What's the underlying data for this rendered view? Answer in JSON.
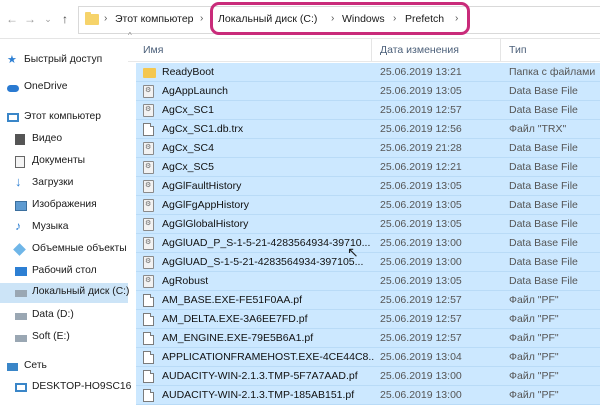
{
  "address": {
    "crumbs": [
      "Этот компьютер",
      "Локальный диск (C:)",
      "Windows",
      "Prefetch"
    ]
  },
  "sidebar": {
    "items": [
      {
        "label": "Быстрый доступ",
        "icon": "star-icon"
      },
      {
        "label": "OneDrive",
        "icon": "cloud-icon"
      },
      {
        "label": "Этот компьютер",
        "icon": "computer-icon"
      },
      {
        "label": "Видео",
        "icon": "video-icon"
      },
      {
        "label": "Документы",
        "icon": "documents-icon"
      },
      {
        "label": "Загрузки",
        "icon": "download-icon"
      },
      {
        "label": "Изображения",
        "icon": "pictures-icon"
      },
      {
        "label": "Музыка",
        "icon": "music-icon"
      },
      {
        "label": "Объемные объекты",
        "icon": "3d-objects-icon"
      },
      {
        "label": "Рабочий стол",
        "icon": "desktop-icon"
      },
      {
        "label": "Локальный диск (C:)",
        "icon": "drive-icon"
      },
      {
        "label": "Data (D:)",
        "icon": "drive-icon"
      },
      {
        "label": "Soft (E:)",
        "icon": "drive-icon"
      },
      {
        "label": "Сеть",
        "icon": "network-icon"
      },
      {
        "label": "DESKTOP-HO9SC16",
        "icon": "computer-icon"
      }
    ]
  },
  "columns": {
    "name": "Имя",
    "date": "Дата изменения",
    "type": "Тип"
  },
  "files": [
    {
      "name": "ReadyBoot",
      "date": "25.06.2019 13:21",
      "type": "Папка с файлами",
      "icon": "folder-icon"
    },
    {
      "name": "AgAppLaunch",
      "date": "25.06.2019 13:05",
      "type": "Data Base File",
      "icon": "database-file-icon"
    },
    {
      "name": "AgCx_SC1",
      "date": "25.06.2019 12:57",
      "type": "Data Base File",
      "icon": "database-file-icon"
    },
    {
      "name": "AgCx_SC1.db.trx",
      "date": "25.06.2019 12:56",
      "type": "Файл \"TRX\"",
      "icon": "file-icon"
    },
    {
      "name": "AgCx_SC4",
      "date": "25.06.2019 21:28",
      "type": "Data Base File",
      "icon": "database-file-icon"
    },
    {
      "name": "AgCx_SC5",
      "date": "25.06.2019 12:21",
      "type": "Data Base File",
      "icon": "database-file-icon"
    },
    {
      "name": "AgGlFaultHistory",
      "date": "25.06.2019 13:05",
      "type": "Data Base File",
      "icon": "database-file-icon"
    },
    {
      "name": "AgGlFgAppHistory",
      "date": "25.06.2019 13:05",
      "type": "Data Base File",
      "icon": "database-file-icon"
    },
    {
      "name": "AgGlGlobalHistory",
      "date": "25.06.2019 13:05",
      "type": "Data Base File",
      "icon": "database-file-icon"
    },
    {
      "name": "AgGlUAD_P_S-1-5-21-4283564934-39710...",
      "date": "25.06.2019 13:00",
      "type": "Data Base File",
      "icon": "database-file-icon"
    },
    {
      "name": "AgGlUAD_S-1-5-21-4283564934-397105...",
      "date": "25.06.2019 13:00",
      "type": "Data Base File",
      "icon": "database-file-icon"
    },
    {
      "name": "AgRobust",
      "date": "25.06.2019 13:05",
      "type": "Data Base File",
      "icon": "database-file-icon"
    },
    {
      "name": "AM_BASE.EXE-FE51F0AA.pf",
      "date": "25.06.2019 12:57",
      "type": "Файл \"PF\"",
      "icon": "file-icon"
    },
    {
      "name": "AM_DELTA.EXE-3A6EE7FD.pf",
      "date": "25.06.2019 12:57",
      "type": "Файл \"PF\"",
      "icon": "file-icon"
    },
    {
      "name": "AM_ENGINE.EXE-79E5B6A1.pf",
      "date": "25.06.2019 12:57",
      "type": "Файл \"PF\"",
      "icon": "file-icon"
    },
    {
      "name": "APPLICATIONFRAMEHOST.EXE-4CE44C8...",
      "date": "25.06.2019 13:04",
      "type": "Файл \"PF\"",
      "icon": "file-icon"
    },
    {
      "name": "AUDACITY-WIN-2.1.3.TMP-5F7A7AAD.pf",
      "date": "25.06.2019 13:00",
      "type": "Файл \"PF\"",
      "icon": "file-icon"
    },
    {
      "name": "AUDACITY-WIN-2.1.3.TMP-185AB151.pf",
      "date": "25.06.2019 13:00",
      "type": "Файл \"PF\"",
      "icon": "file-icon"
    }
  ]
}
